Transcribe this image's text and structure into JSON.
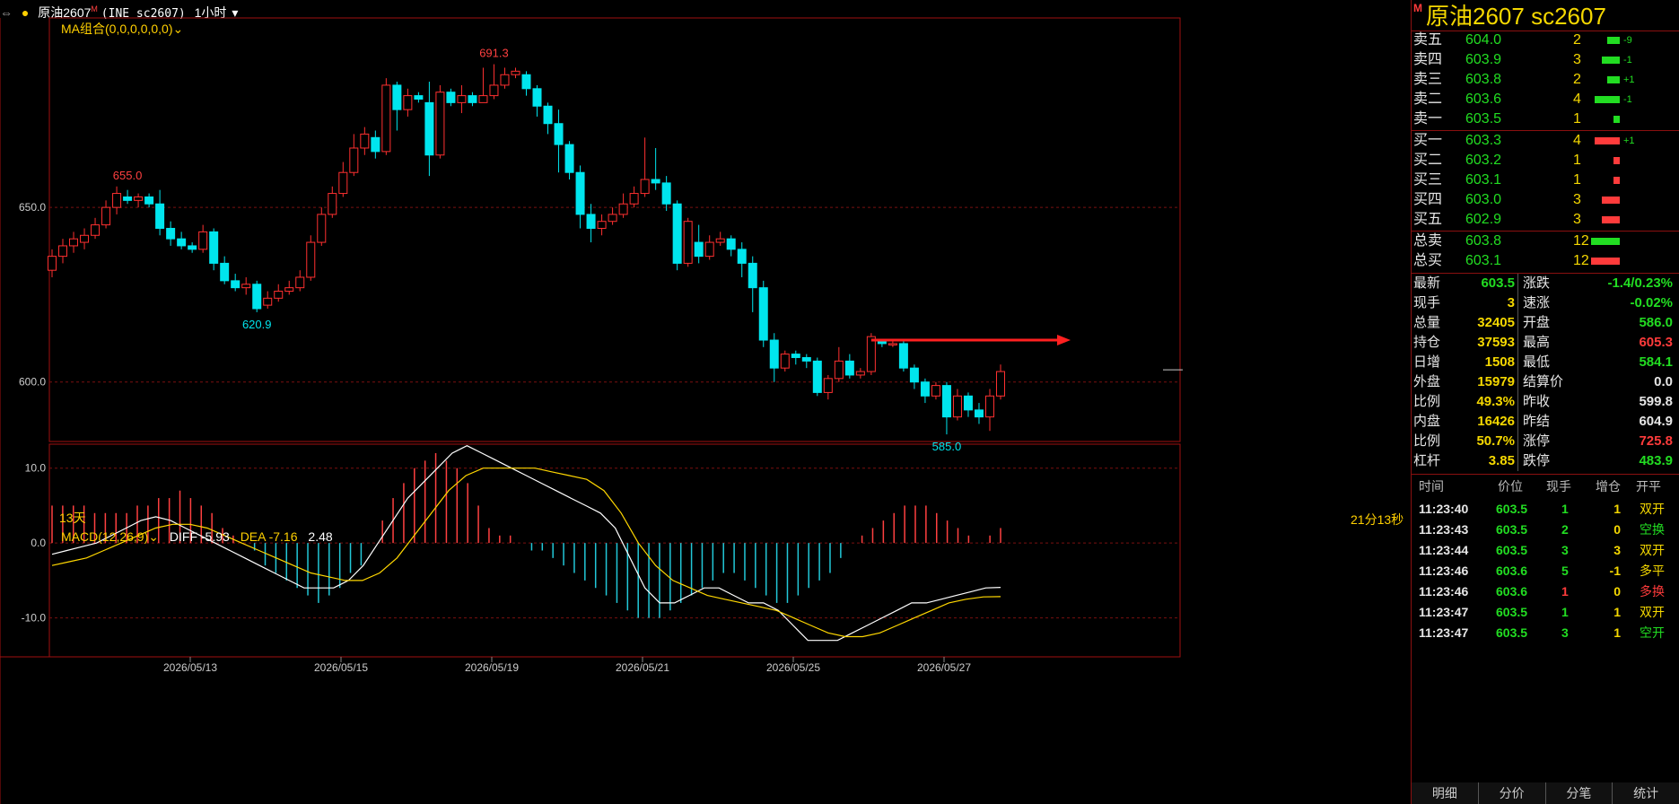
{
  "header": {
    "symbol": "原油2607",
    "badge": "M",
    "exchange": "(INE sc2607)",
    "period": "1小时"
  },
  "ma_label": "MA组合(0,0,0,0,0,0)",
  "bottom_left_label": "13天",
  "countdown": "21分13秒",
  "macd": {
    "label": "MACD(12,26,9)",
    "diff": "DIFF -5.93",
    "dea": "DEA -7.16",
    "macd": "2.48"
  },
  "annotations": {
    "high": "691.3",
    "left_high": "655.0",
    "low_left": "620.9",
    "low_right": "585.0"
  },
  "colors": {
    "up": "#ff3030",
    "down": "#00e5ee",
    "ma_white": "#ffffff",
    "ma_yellow": "#ffd700",
    "frame": "#a01010"
  },
  "chart_data": [
    {
      "type": "candlestick",
      "y_ticks": [
        "650.0",
        "600.0"
      ],
      "x_ticks": [
        "2026/05/13",
        "2026/05/15",
        "2026/05/19",
        "2026/05/21",
        "2026/05/25",
        "2026/05/27"
      ],
      "ylim": [
        584,
        695
      ],
      "candles": [
        [
          632,
          636,
          630,
          638
        ],
        [
          636,
          639,
          634,
          641
        ],
        [
          639,
          641,
          637,
          643
        ],
        [
          640,
          642,
          638,
          644
        ],
        [
          642,
          645,
          641,
          647
        ],
        [
          645,
          650,
          644,
          652
        ],
        [
          650,
          654,
          648,
          656
        ],
        [
          653,
          652,
          651,
          655
        ],
        [
          652,
          653,
          650,
          654
        ],
        [
          653,
          651,
          650,
          654
        ],
        [
          651,
          644,
          642,
          655
        ],
        [
          644,
          641,
          639,
          646
        ],
        [
          641,
          639,
          638,
          643
        ],
        [
          639,
          638,
          637,
          640
        ],
        [
          638,
          643,
          637,
          645
        ],
        [
          643,
          634,
          632,
          644
        ],
        [
          634,
          629,
          628,
          636
        ],
        [
          629,
          627,
          626,
          631
        ],
        [
          627,
          628,
          625,
          630
        ],
        [
          628,
          621,
          620,
          629
        ],
        [
          622,
          624,
          621,
          626
        ],
        [
          624,
          626,
          623,
          628
        ],
        [
          626,
          627,
          625,
          629
        ],
        [
          627,
          630,
          626,
          632
        ],
        [
          630,
          640,
          629,
          642
        ],
        [
          640,
          648,
          639,
          650
        ],
        [
          648,
          654,
          647,
          656
        ],
        [
          654,
          660,
          653,
          663
        ],
        [
          660,
          667,
          659,
          671
        ],
        [
          667,
          671,
          665,
          673
        ],
        [
          670,
          666,
          664,
          672
        ],
        [
          666,
          685,
          665,
          687
        ],
        [
          685,
          678,
          672,
          686
        ],
        [
          678,
          682,
          676,
          684
        ],
        [
          682,
          681,
          680,
          683
        ],
        [
          680,
          665,
          659,
          686
        ],
        [
          665,
          683,
          664,
          685
        ],
        [
          683,
          680,
          679,
          684
        ],
        [
          680,
          682,
          677,
          685
        ],
        [
          682,
          680,
          679,
          683
        ],
        [
          680,
          682,
          680,
          690
        ],
        [
          682,
          685,
          681,
          691
        ],
        [
          685,
          688,
          684,
          690
        ],
        [
          688,
          689,
          687,
          690
        ],
        [
          688,
          684,
          682,
          689
        ],
        [
          684,
          679,
          676,
          685
        ],
        [
          679,
          674,
          671,
          680
        ],
        [
          674,
          668,
          660,
          678
        ],
        [
          668,
          660,
          658,
          669
        ],
        [
          660,
          648,
          644,
          662
        ],
        [
          648,
          644,
          640,
          651
        ],
        [
          644,
          646,
          642,
          648
        ],
        [
          646,
          648,
          645,
          650
        ],
        [
          648,
          651,
          647,
          654
        ],
        [
          651,
          654,
          650,
          656
        ],
        [
          654,
          658,
          653,
          670
        ],
        [
          658,
          657,
          655,
          667
        ],
        [
          657,
          651,
          649,
          659
        ],
        [
          651,
          634,
          632,
          652
        ],
        [
          634,
          646,
          633,
          647
        ],
        [
          640,
          636,
          634,
          645
        ],
        [
          636,
          640,
          635,
          642
        ],
        [
          640,
          641,
          639,
          643
        ],
        [
          641,
          638,
          636,
          642
        ],
        [
          638,
          634,
          630,
          640
        ],
        [
          634,
          627,
          620,
          636
        ],
        [
          627,
          612,
          610,
          629
        ],
        [
          612,
          604,
          600,
          614
        ],
        [
          604,
          608,
          603,
          609
        ],
        [
          608,
          607,
          605,
          609
        ],
        [
          607,
          606,
          604,
          608
        ],
        [
          606,
          597,
          596,
          607
        ],
        [
          597,
          601,
          595,
          602
        ],
        [
          601,
          606,
          600,
          610
        ],
        [
          606,
          602,
          601,
          608
        ],
        [
          602,
          603,
          601,
          604
        ],
        [
          603,
          613,
          602,
          614
        ],
        [
          612,
          611,
          610,
          612
        ],
        [
          611,
          611,
          610,
          612
        ],
        [
          611,
          604,
          603,
          612
        ],
        [
          604,
          600,
          598,
          605
        ],
        [
          600,
          596,
          594,
          601
        ],
        [
          596,
          599,
          595,
          600
        ],
        [
          599,
          590,
          585,
          600
        ],
        [
          590,
          596,
          589,
          598
        ],
        [
          596,
          592,
          590,
          597
        ],
        [
          592,
          590,
          588,
          594
        ],
        [
          590,
          596,
          586,
          598
        ],
        [
          596,
          603,
          595,
          605
        ]
      ]
    },
    {
      "type": "bar+line",
      "name_labels": [
        "DIFF",
        "DEA",
        "MACD"
      ],
      "y_ticks": [
        "10.0",
        "0.0",
        "-10.0"
      ],
      "ylim": [
        -14,
        12
      ],
      "macd_hist": [
        5,
        5,
        5,
        5,
        4,
        4,
        4,
        4,
        5,
        5,
        6,
        6,
        7,
        6,
        5,
        4,
        2,
        1,
        0,
        -1,
        -3,
        -4,
        -5,
        -6,
        -7,
        -8,
        -7,
        -6,
        -4,
        -3,
        0,
        3,
        6,
        8,
        10,
        11,
        12,
        11,
        10,
        8,
        5,
        2,
        1,
        1,
        0,
        -1,
        -1,
        -2,
        -3,
        -4,
        -5,
        -6,
        -7,
        -8,
        -9,
        -10,
        -10,
        -10,
        -9,
        -8,
        -7,
        -6,
        -5,
        -4,
        -4,
        -5,
        -6,
        -7,
        -8,
        -8,
        -7,
        -6,
        -5,
        -4,
        -2,
        0,
        1,
        2,
        3,
        4,
        5,
        5,
        5,
        4,
        3,
        2,
        1,
        0,
        1,
        2
      ],
      "diff": [
        -1.5,
        -1,
        -0.5,
        0,
        1,
        2,
        3,
        3.5,
        3,
        2,
        1,
        0,
        -1,
        -2,
        -3,
        -4,
        -5,
        -6,
        -6,
        -6,
        -5,
        -3,
        0,
        3,
        6,
        8,
        10,
        12,
        13,
        12,
        11,
        10,
        9,
        8,
        7,
        6,
        5,
        4,
        2,
        -2,
        -6,
        -8,
        -8,
        -7,
        -6,
        -6,
        -7,
        -8,
        -8,
        -9,
        -11,
        -13,
        -13,
        -13,
        -12,
        -11,
        -10,
        -9,
        -8,
        -8,
        -7.5,
        -7,
        -6.5,
        -6,
        -5.93
      ],
      "dea": [
        -3,
        -2.5,
        -2,
        -1,
        0,
        1,
        2,
        2.5,
        2.5,
        2,
        1,
        0,
        -1,
        -2,
        -3,
        -4,
        -4.5,
        -5,
        -5,
        -4,
        -2,
        1,
        4,
        7,
        9,
        10,
        10,
        10,
        10,
        9.5,
        9,
        8.5,
        7,
        4,
        0,
        -3,
        -5,
        -6,
        -7,
        -7.5,
        -8,
        -8.5,
        -9,
        -10,
        -11,
        -12,
        -12.5,
        -12.5,
        -12,
        -11,
        -10,
        -9,
        -8,
        -7.5,
        -7.2,
        -7.16
      ]
    }
  ],
  "quote": {
    "title": "原油2607  sc2607",
    "badge": "M",
    "asks": [
      {
        "label": "卖五",
        "price": "604.0",
        "vol": "2",
        "chg": "-9",
        "bar": 14
      },
      {
        "label": "卖四",
        "price": "603.9",
        "vol": "3",
        "chg": "-1",
        "bar": 20
      },
      {
        "label": "卖三",
        "price": "603.8",
        "vol": "2",
        "chg": "+1",
        "bar": 14
      },
      {
        "label": "卖二",
        "price": "603.6",
        "vol": "4",
        "chg": "-1",
        "bar": 28
      },
      {
        "label": "卖一",
        "price": "603.5",
        "vol": "1",
        "chg": "",
        "bar": 7
      }
    ],
    "bids": [
      {
        "label": "买一",
        "price": "603.3",
        "vol": "4",
        "chg": "+1",
        "bar": 28
      },
      {
        "label": "买二",
        "price": "603.2",
        "vol": "1",
        "chg": "",
        "bar": 7
      },
      {
        "label": "买三",
        "price": "603.1",
        "vol": "1",
        "chg": "",
        "bar": 7
      },
      {
        "label": "买四",
        "price": "603.0",
        "vol": "3",
        "chg": "",
        "bar": 20
      },
      {
        "label": "买五",
        "price": "602.9",
        "vol": "3",
        "chg": "",
        "bar": 20
      }
    ],
    "totals": [
      {
        "label": "总卖",
        "price": "603.8",
        "vol": "12",
        "color": "green"
      },
      {
        "label": "总买",
        "price": "603.1",
        "vol": "12",
        "color": "red"
      }
    ],
    "stats": [
      {
        "l1": "最新",
        "v1": "603.5",
        "c1": "green",
        "l2": "涨跌",
        "v2": "-1.4/0.23%",
        "c2": "green"
      },
      {
        "l1": "现手",
        "v1": "3",
        "c1": "yel",
        "l2": "速涨",
        "v2": "-0.02%",
        "c2": "green"
      },
      {
        "l1": "总量",
        "v1": "32405",
        "c1": "yel",
        "l2": "开盘",
        "v2": "586.0",
        "c2": "green"
      },
      {
        "l1": "持仓",
        "v1": "37593",
        "c1": "yel",
        "l2": "最高",
        "v2": "605.3",
        "c2": "red"
      },
      {
        "l1": "日增",
        "v1": "1508",
        "c1": "yel",
        "l2": "最低",
        "v2": "584.1",
        "c2": "green"
      },
      {
        "l1": "外盘",
        "v1": "15979",
        "c1": "yel",
        "l2": "结算价",
        "v2": "0.0",
        "c2": "white"
      },
      {
        "l1": "比例",
        "v1": "49.3%",
        "c1": "yel",
        "l2": "昨收",
        "v2": "599.8",
        "c2": "white"
      },
      {
        "l1": "内盘",
        "v1": "16426",
        "c1": "yel",
        "l2": "昨结",
        "v2": "604.9",
        "c2": "white"
      },
      {
        "l1": "比例",
        "v1": "50.7%",
        "c1": "yel",
        "l2": "涨停",
        "v2": "725.8",
        "c2": "red"
      },
      {
        "l1": "杠杆",
        "v1": "3.85",
        "c1": "yel",
        "l2": "跌停",
        "v2": "483.9",
        "c2": "green"
      }
    ],
    "ticks_header": [
      "时间",
      "价位",
      "现手",
      "增仓",
      "开平"
    ],
    "ticks": [
      {
        "t": "11:23:40",
        "p": "603.5",
        "pc": "green",
        "v": "1",
        "vc": "green",
        "d": "1",
        "dc": "yel",
        "k": "双开",
        "kc": "yel"
      },
      {
        "t": "11:23:43",
        "p": "603.5",
        "pc": "green",
        "v": "2",
        "vc": "green",
        "d": "0",
        "dc": "yel",
        "k": "空换",
        "kc": "green"
      },
      {
        "t": "11:23:44",
        "p": "603.5",
        "pc": "green",
        "v": "3",
        "vc": "green",
        "d": "3",
        "dc": "yel",
        "k": "双开",
        "kc": "yel"
      },
      {
        "t": "11:23:46",
        "p": "603.6",
        "pc": "green",
        "v": "5",
        "vc": "green",
        "d": "-1",
        "dc": "yel",
        "k": "多平",
        "kc": "yel"
      },
      {
        "t": "11:23:46",
        "p": "603.6",
        "pc": "green",
        "v": "1",
        "vc": "red",
        "d": "0",
        "dc": "yel",
        "k": "多换",
        "kc": "red"
      },
      {
        "t": "11:23:47",
        "p": "603.5",
        "pc": "green",
        "v": "1",
        "vc": "green",
        "d": "1",
        "dc": "yel",
        "k": "双开",
        "kc": "yel"
      },
      {
        "t": "11:23:47",
        "p": "603.5",
        "pc": "green",
        "v": "3",
        "vc": "green",
        "d": "1",
        "dc": "yel",
        "k": "空开",
        "kc": "green"
      }
    ],
    "tabs": [
      "明细",
      "分价",
      "分笔",
      "统计"
    ]
  }
}
